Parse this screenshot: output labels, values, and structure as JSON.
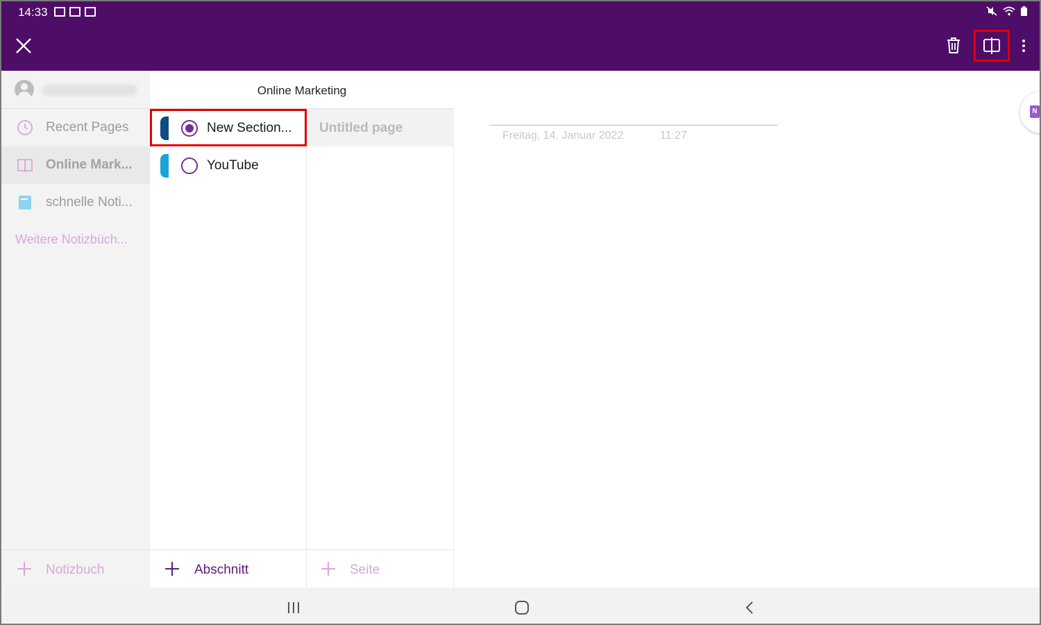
{
  "status_bar": {
    "time": "14:33"
  },
  "colors": {
    "brand": "#4e0d66",
    "accent": "#7b2b94",
    "highlight": "#e00000"
  },
  "toolbar": {
    "close_icon": "close-icon",
    "delete_icon": "trash-icon",
    "split_view_icon": "split-view-icon",
    "more_icon": "more-vertical-icon"
  },
  "sidebar": {
    "items": [
      {
        "label": "Recent Pages",
        "icon": "clock-icon"
      },
      {
        "label": "Online Mark...",
        "icon": "notebook-icon",
        "active": true
      },
      {
        "label": "schnelle Noti...",
        "icon": "notebook-icon"
      }
    ],
    "more_notebooks": "Weitere Notizbüch...",
    "add_notebook": "Notizbuch"
  },
  "notebook": {
    "title": "Online Marketing"
  },
  "sections": {
    "items": [
      {
        "label": "New Section...",
        "color": "#0f4c81",
        "selected": true
      },
      {
        "label": "YouTube",
        "color": "#1aa3d8",
        "selected": false
      }
    ],
    "add_label": "Abschnitt"
  },
  "pages": {
    "items": [
      {
        "label": "Untitled page"
      }
    ],
    "add_label": "Seite"
  },
  "page": {
    "date": "Freitag, 14. Januar 2022",
    "time": "11:27"
  },
  "badge": {
    "letter": "N"
  }
}
